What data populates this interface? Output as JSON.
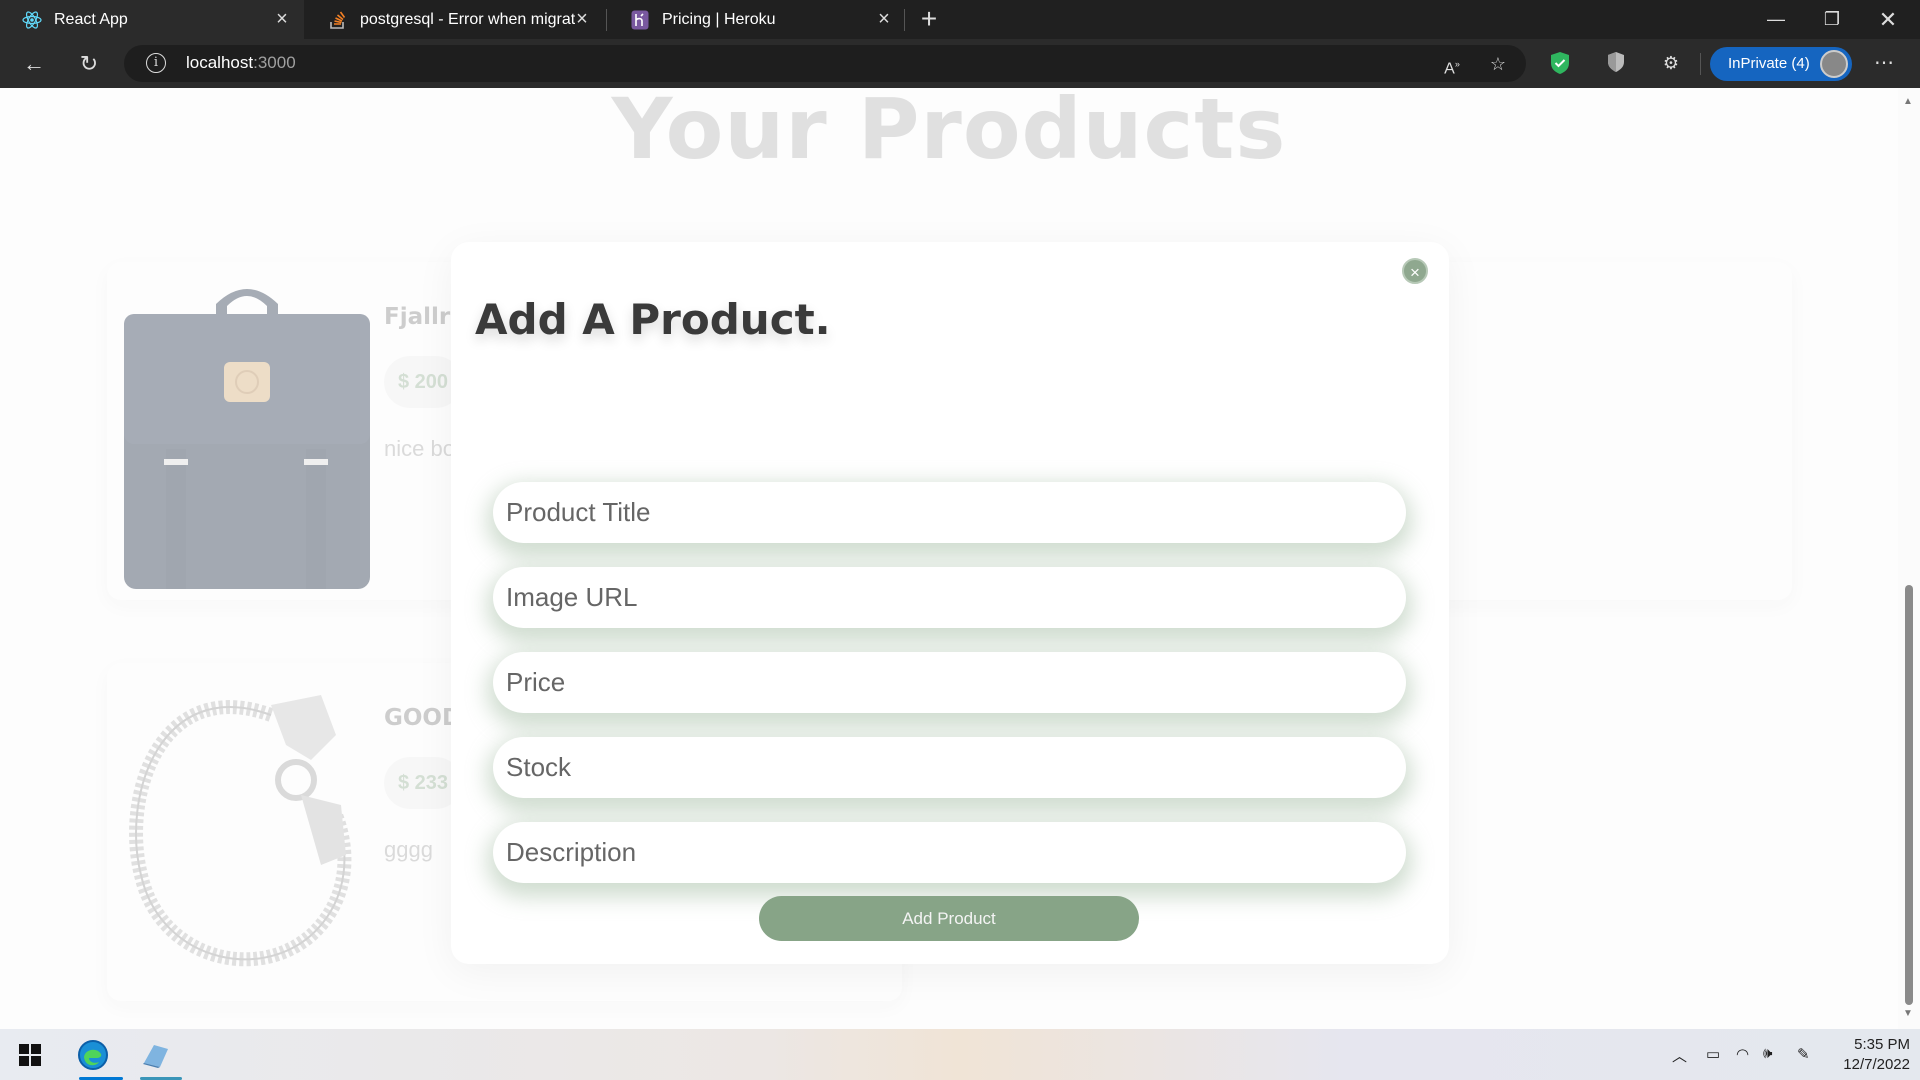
{
  "browser": {
    "tabs": [
      {
        "title": "React App",
        "active": true
      },
      {
        "title": "postgresql - Error when migratin",
        "active": false
      },
      {
        "title": "Pricing | Heroku",
        "active": false
      }
    ],
    "address": {
      "host": "localhost",
      "port": ":3000"
    },
    "inprivate_label": "InPrivate (4)"
  },
  "page": {
    "heading": "Your Products",
    "products": [
      {
        "title": "Fjallr",
        "price": "$ 200",
        "description": "nice bo"
      },
      {
        "title": "GOOD",
        "price": "$ 233",
        "description": "gggg"
      }
    ]
  },
  "modal": {
    "title": "Add A Product.",
    "close_label": "×",
    "fields": {
      "title_placeholder": "Product Title",
      "image_placeholder": "Image URL",
      "price_placeholder": "Price",
      "stock_placeholder": "Stock",
      "description_placeholder": "Description"
    },
    "submit_label": "Add Product"
  },
  "taskbar": {
    "time": "5:35 PM",
    "date": "12/7/2022"
  },
  "colors": {
    "accent_green": "#87a487",
    "browser_dark": "#202020",
    "inprivate_blue": "#1565c0"
  }
}
